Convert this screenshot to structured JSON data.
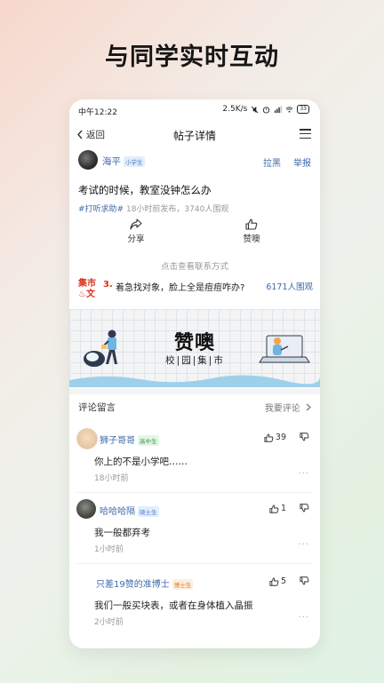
{
  "promo": {
    "title": "与同学实时互动"
  },
  "status_bar": {
    "time": "中午12:22",
    "network_speed": "2.5K/s",
    "battery": "33"
  },
  "nav": {
    "back_label": "返回",
    "title": "帖子详情"
  },
  "author": {
    "name": "海平",
    "badge": "小学生",
    "block_label": "拉黑",
    "report_label": "举报"
  },
  "post": {
    "text": "考试的时候，教室没钟怎么办",
    "tag": "#打听求助#",
    "meta": "18小时前发布，3740人围观",
    "share_label": "分享",
    "like_label": "赞噢",
    "contact_label": "点击查看联系方式"
  },
  "hot": {
    "label_line1": "集市",
    "label_line2": "文",
    "num": "3.",
    "text": "着急找对象，脸上全是痘痘咋办?",
    "views": "6171人围观"
  },
  "banner": {
    "title": "赞噢",
    "sub": [
      "校",
      "园",
      "集",
      "市"
    ]
  },
  "comments_section": {
    "title": "评论留言",
    "cta": "我要评论"
  },
  "comments": [
    {
      "name": "狮子哥哥",
      "badge": "高中生",
      "likes": "39",
      "text": "你上的不是小学吧……",
      "time": "18小时前",
      "more": "···"
    },
    {
      "name": "哈哈哈隔",
      "badge": "硕士生",
      "likes": "1",
      "text": "我一般都弃考",
      "time": "1小时前",
      "more": "···"
    },
    {
      "name": "只差19赞的准博士",
      "badge": "博士生",
      "likes": "5",
      "text": "我们一般买块表，或者在身体植入晶振",
      "time": "2小时前",
      "more": "···"
    }
  ],
  "colors": {
    "link_blue": "#3f69a8",
    "hot_red": "#d9341f",
    "banner_wave": "#9fd0ea"
  }
}
